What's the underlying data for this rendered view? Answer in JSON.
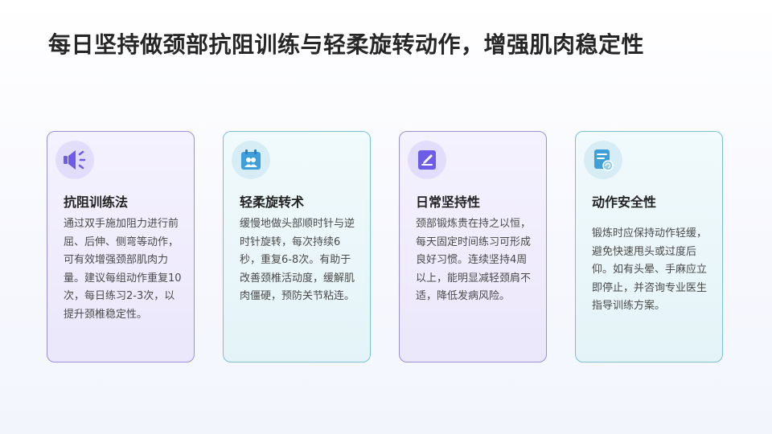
{
  "title": "每日坚持做颈部抗阻训练与轻柔旋转动作，增强肌肉稳定性",
  "colors": {
    "purple_border": "#9b8fd6",
    "teal_border": "#78c3d2",
    "purple_icon": "#6c5ce7",
    "teal_icon": "#3f9fd8"
  },
  "cards": [
    {
      "icon": "speaker-icon",
      "title": "抗阻训练法",
      "text": "通过双手施加阻力进行前屈、后伸、侧弯等动作，可有效增强颈部肌肉力量。建议每组动作重复10次，每日练习2-3次，以提升颈椎稳定性。"
    },
    {
      "icon": "calendar-people-icon",
      "title": "轻柔旋转术",
      "text": "缓慢地做头部顺时针与逆时针旋转，每次持续6秒，重复6-8次。有助于改善颈椎活动度，缓解肌肉僵硬，预防关节粘连。"
    },
    {
      "icon": "note-pen-icon",
      "title": "日常坚持性",
      "text": "颈部锻炼贵在持之以恒，每天固定时间练习可形成良好习惯。连续坚持4周以上，能明显减轻颈肩不适，降低发病风险。"
    },
    {
      "icon": "document-refresh-icon",
      "title": "动作安全性",
      "text": "锻炼时应保持动作轻缓，避免快速甩头或过度后仰。如有头晕、手麻应立即停止，并咨询专业医生指导训练方案。"
    }
  ]
}
